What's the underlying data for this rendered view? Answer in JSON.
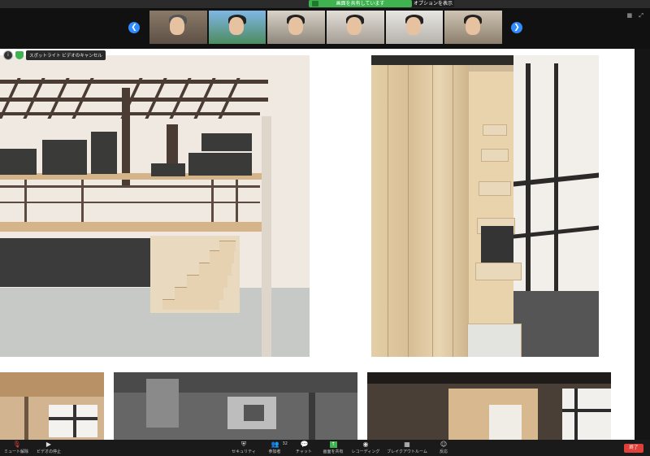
{
  "top": {
    "share_status": "画面を共有しています",
    "options_label": "オプションを表示 ⌄"
  },
  "participants": [
    {
      "name": ""
    },
    {
      "name": ""
    },
    {
      "name": ""
    },
    {
      "name": ""
    },
    {
      "name": ""
    },
    {
      "name": ""
    }
  ],
  "spotlight": {
    "cancel_label": "スポットライト ビデオのキャンセル"
  },
  "toolbar": {
    "mute": "ミュート解除",
    "stop_video": "ビデオの停止",
    "security": "セキュリティ",
    "participants": "参加者",
    "participants_count": "32",
    "chat": "チャット",
    "share": "画面を共有",
    "record": "レコーディング",
    "breakout": "ブレイクアウトルーム",
    "reactions": "反応",
    "end": "終了"
  },
  "colors": {
    "share_green": "#3fb34f",
    "nav_blue": "#2f8cff",
    "end_red": "#e0403a"
  }
}
